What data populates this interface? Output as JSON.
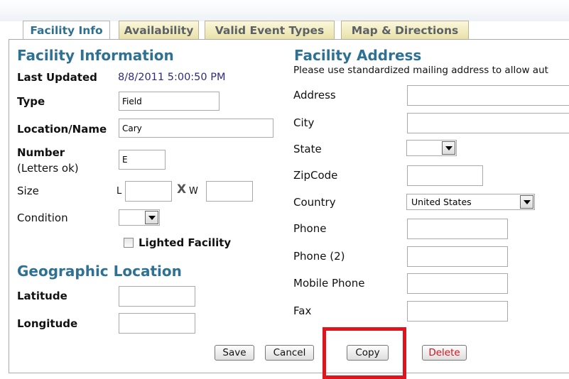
{
  "tabs": [
    {
      "label": "Facility Info",
      "active": true
    },
    {
      "label": "Availability",
      "active": false
    },
    {
      "label": "Valid Event Types",
      "active": false
    },
    {
      "label": "Map & Directions",
      "active": false
    }
  ],
  "facility_info": {
    "title": "Facility Information",
    "last_updated_label": "Last Updated",
    "last_updated_value": "8/8/2011 5:00:50 PM",
    "type_label": "Type",
    "type_value": "Field",
    "location_label": "Location/Name",
    "location_value": "Cary",
    "number_label": "Number",
    "number_hint": "(Letters ok)",
    "number_value": "E",
    "size_label": "Size",
    "size_l_label": "L",
    "size_x_label": "X",
    "size_w_label": "W",
    "size_l_value": "",
    "size_w_value": "",
    "condition_label": "Condition",
    "condition_value": "",
    "lighted_label": "Lighted Facility",
    "lighted_checked": false
  },
  "geo": {
    "title": "Geographic Location",
    "latitude_label": "Latitude",
    "latitude_value": "",
    "longitude_label": "Longitude",
    "longitude_value": ""
  },
  "address": {
    "title": "Facility Address",
    "note": "Please use standardized mailing address to allow aut",
    "address_label": "Address",
    "address_value": "",
    "city_label": "City",
    "city_value": "",
    "state_label": "State",
    "state_value": "",
    "zip_label": "ZipCode",
    "zip_value": "",
    "country_label": "Country",
    "country_value": "United States",
    "phone_label": "Phone",
    "phone_value": "",
    "phone2_label": "Phone (2)",
    "phone2_value": "",
    "mobile_label": "Mobile Phone",
    "mobile_value": "",
    "fax_label": "Fax",
    "fax_value": ""
  },
  "buttons": {
    "save": "Save",
    "cancel": "Cancel",
    "copy": "Copy",
    "delete": "Delete"
  },
  "colors": {
    "section_heading": "#2f7192",
    "value_text": "#2e2c7a",
    "delete_text": "#d8101a",
    "highlight_box": "#e0141c"
  }
}
